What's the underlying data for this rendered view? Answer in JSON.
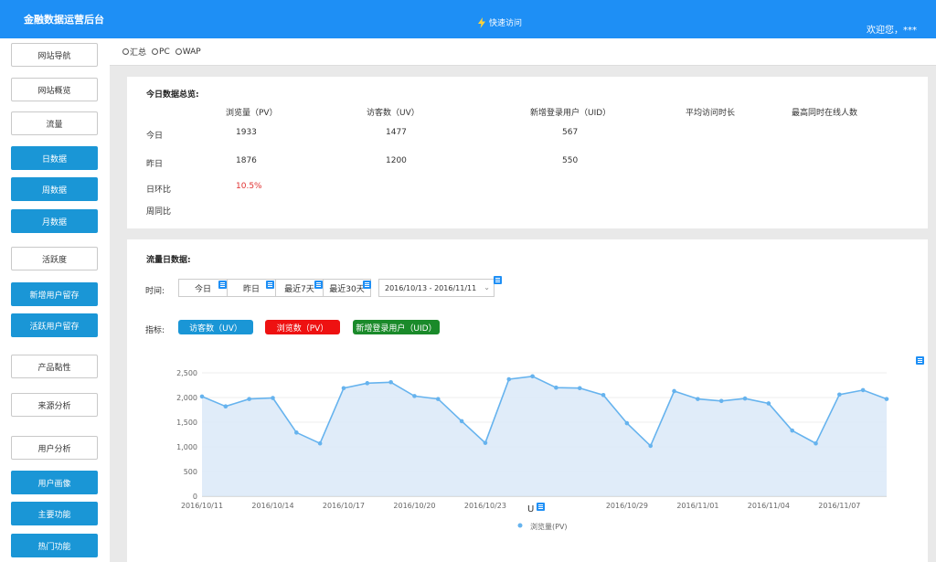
{
  "header": {
    "title": "金融数据运营后台",
    "quick_access": "快速访问",
    "welcome": "欢迎您，***"
  },
  "sidebar": {
    "items": [
      {
        "label": "网站导航",
        "style": "plain"
      },
      {
        "label": "网站概览",
        "style": "plain"
      },
      {
        "label": "流量",
        "style": "plain"
      },
      {
        "label": "日数据",
        "style": "blue"
      },
      {
        "label": "周数据",
        "style": "blue"
      },
      {
        "label": "月数据",
        "style": "blue"
      },
      {
        "label": "活跃度",
        "style": "plain"
      },
      {
        "label": "新增用户留存",
        "style": "blue"
      },
      {
        "label": "活跃用户留存",
        "style": "blue"
      },
      {
        "label": "产品黏性",
        "style": "plain"
      },
      {
        "label": "来源分析",
        "style": "plain"
      },
      {
        "label": "用户分析",
        "style": "plain"
      },
      {
        "label": "用户画像",
        "style": "blue"
      },
      {
        "label": "主要功能",
        "style": "blue"
      },
      {
        "label": "热门功能",
        "style": "blue"
      }
    ]
  },
  "filter": {
    "options": [
      "汇总",
      "PC",
      "WAP"
    ]
  },
  "summary": {
    "title": "今日数据总览:",
    "columns": [
      "浏览量（PV）",
      "访客数（UV）",
      "新增登录用户（UID）",
      "平均访问时长",
      "最高同时在线人数"
    ],
    "rows": [
      {
        "label": "今日",
        "values": [
          "1933",
          "1477",
          "567"
        ]
      },
      {
        "label": "昨日",
        "values": [
          "1876",
          "1200",
          "550"
        ]
      },
      {
        "label": "日环比",
        "values": [
          "10.5%"
        ]
      },
      {
        "label": "周同比",
        "values": []
      }
    ]
  },
  "traffic": {
    "title": "流量日数据:",
    "time_label": "时间:",
    "ranges": [
      "今日",
      "昨日",
      "最近7天",
      "最近30天"
    ],
    "date_range": "2016/10/13 - 2016/11/11",
    "indicator_label": "指标:",
    "indicators": [
      {
        "label": "访客数（UV）",
        "color": "#1a96d6"
      },
      {
        "label": "浏览数（PV）",
        "color": "#ee1111"
      },
      {
        "label": "新增登录用户（UID）",
        "color": "#1a8a2a"
      }
    ],
    "axis_stray_label": "U"
  },
  "chart_data": {
    "type": "area",
    "x": [
      "2016/10/11",
      "2016/10/12",
      "2016/10/13",
      "2016/10/14",
      "2016/10/15",
      "2016/10/16",
      "2016/10/17",
      "2016/10/18",
      "2016/10/19",
      "2016/10/20",
      "2016/10/21",
      "2016/10/22",
      "2016/10/23",
      "2016/10/24",
      "2016/10/25",
      "2016/10/26",
      "2016/10/27",
      "2016/10/28",
      "2016/10/29",
      "2016/10/30",
      "2016/10/31",
      "2016/11/01",
      "2016/11/02",
      "2016/11/03",
      "2016/11/04",
      "2016/11/05",
      "2016/11/06",
      "2016/11/07",
      "2016/11/08",
      "2016/11/09"
    ],
    "xticks": [
      "2016/10/11",
      "2016/10/14",
      "2016/10/17",
      "2016/10/20",
      "2016/10/23",
      "",
      "2016/10/29",
      "2016/11/01",
      "2016/11/04",
      "2016/11/07"
    ],
    "series": [
      {
        "name": "浏览量(PV)",
        "color": "#66b3ee",
        "values": [
          2020,
          1820,
          1970,
          1990,
          1290,
          1070,
          2190,
          2290,
          2310,
          2030,
          1970,
          1520,
          1080,
          2370,
          2430,
          2200,
          2190,
          2050,
          1480,
          1020,
          2130,
          1970,
          1930,
          1980,
          1880,
          1330,
          1070,
          2060,
          2150,
          1970
        ]
      }
    ],
    "yticks": [
      "2,500",
      "2,000",
      "1,500",
      "1,000",
      "500",
      "0"
    ],
    "ylim": [
      0,
      2500
    ],
    "grid": true,
    "legend": "bottom"
  }
}
